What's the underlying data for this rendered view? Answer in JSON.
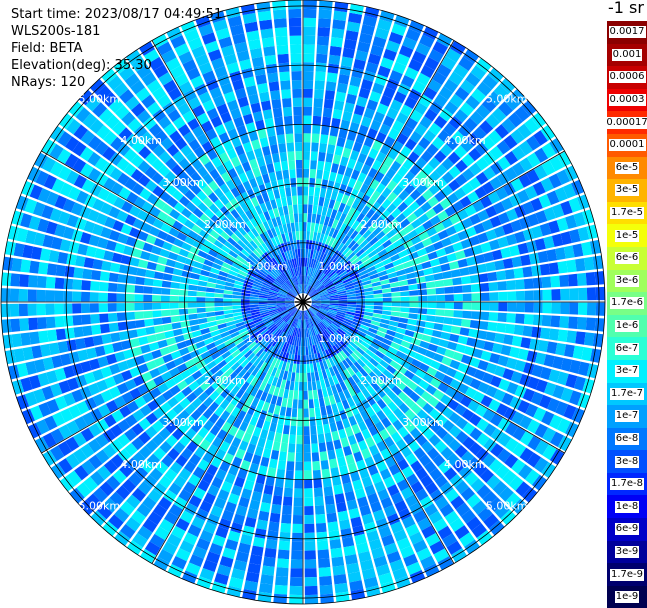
{
  "info": {
    "start_time": "Start time: 2023/08/17 04:49:51",
    "instrument": "WLS200s-181",
    "field": "Field: BETA",
    "elevation": "Elevation(deg): 35.30",
    "nrays": "NRays: 120"
  },
  "colorbar": {
    "units_label": "-1 sr",
    "entries": [
      {
        "label": "0.0017",
        "color": "#8b0000"
      },
      {
        "label": "0.001",
        "color": "#a50000"
      },
      {
        "label": "0.0006",
        "color": "#c80000"
      },
      {
        "label": "0.0003",
        "color": "#ee0000"
      },
      {
        "label": "0.00017",
        "color": "#ff2a00"
      },
      {
        "label": "0.0001",
        "color": "#ff5a00"
      },
      {
        "label": "6e-5",
        "color": "#ff8a00"
      },
      {
        "label": "3e-5",
        "color": "#ffb400"
      },
      {
        "label": "1.7e-5",
        "color": "#ffde00"
      },
      {
        "label": "1e-5",
        "color": "#f4ff0a"
      },
      {
        "label": "6e-6",
        "color": "#c8ff34"
      },
      {
        "label": "3e-6",
        "color": "#a0ff5c"
      },
      {
        "label": "1.7e-6",
        "color": "#78ff86"
      },
      {
        "label": "1e-6",
        "color": "#50ffae"
      },
      {
        "label": "6e-7",
        "color": "#2affd6"
      },
      {
        "label": "3e-7",
        "color": "#00f0ff"
      },
      {
        "label": "1.7e-7",
        "color": "#00c8ff"
      },
      {
        "label": "1e-7",
        "color": "#00a0ff"
      },
      {
        "label": "6e-8",
        "color": "#0078ff"
      },
      {
        "label": "3e-8",
        "color": "#0050ff"
      },
      {
        "label": "1.7e-8",
        "color": "#0028ff"
      },
      {
        "label": "1e-8",
        "color": "#0000f5"
      },
      {
        "label": "6e-9",
        "color": "#0000c8"
      },
      {
        "label": "3e-9",
        "color": "#00009b"
      },
      {
        "label": "1.7e-9",
        "color": "#00006e"
      },
      {
        "label": "1e-9",
        "color": "#000050"
      }
    ]
  },
  "chart_data": {
    "type": "heatmap",
    "projection": "polar (PPI)",
    "n_rays": 120,
    "elevation_deg": 35.3,
    "field": "BETA",
    "range_max_km": 5.1,
    "range_rings_km": [
      1,
      2,
      3,
      4,
      5
    ],
    "azimuth_spokes_deg": [
      0,
      30,
      60,
      90,
      120,
      150,
      180,
      210,
      240,
      270,
      300,
      330
    ],
    "ring_labels": [
      "1.00km",
      "2.00km",
      "3.00km",
      "4.00km",
      "5.00km"
    ],
    "value_scale": "log",
    "value_range": [
      1e-09,
      0.0017
    ],
    "dominant_values": {
      "near_field_center_le_1km": "3e-8 to 1e-7",
      "mid_field_1_to_3km": "1e-7 to 6e-7",
      "far_field_3_to_5km": "3e-8 to 1.7e-7"
    }
  }
}
